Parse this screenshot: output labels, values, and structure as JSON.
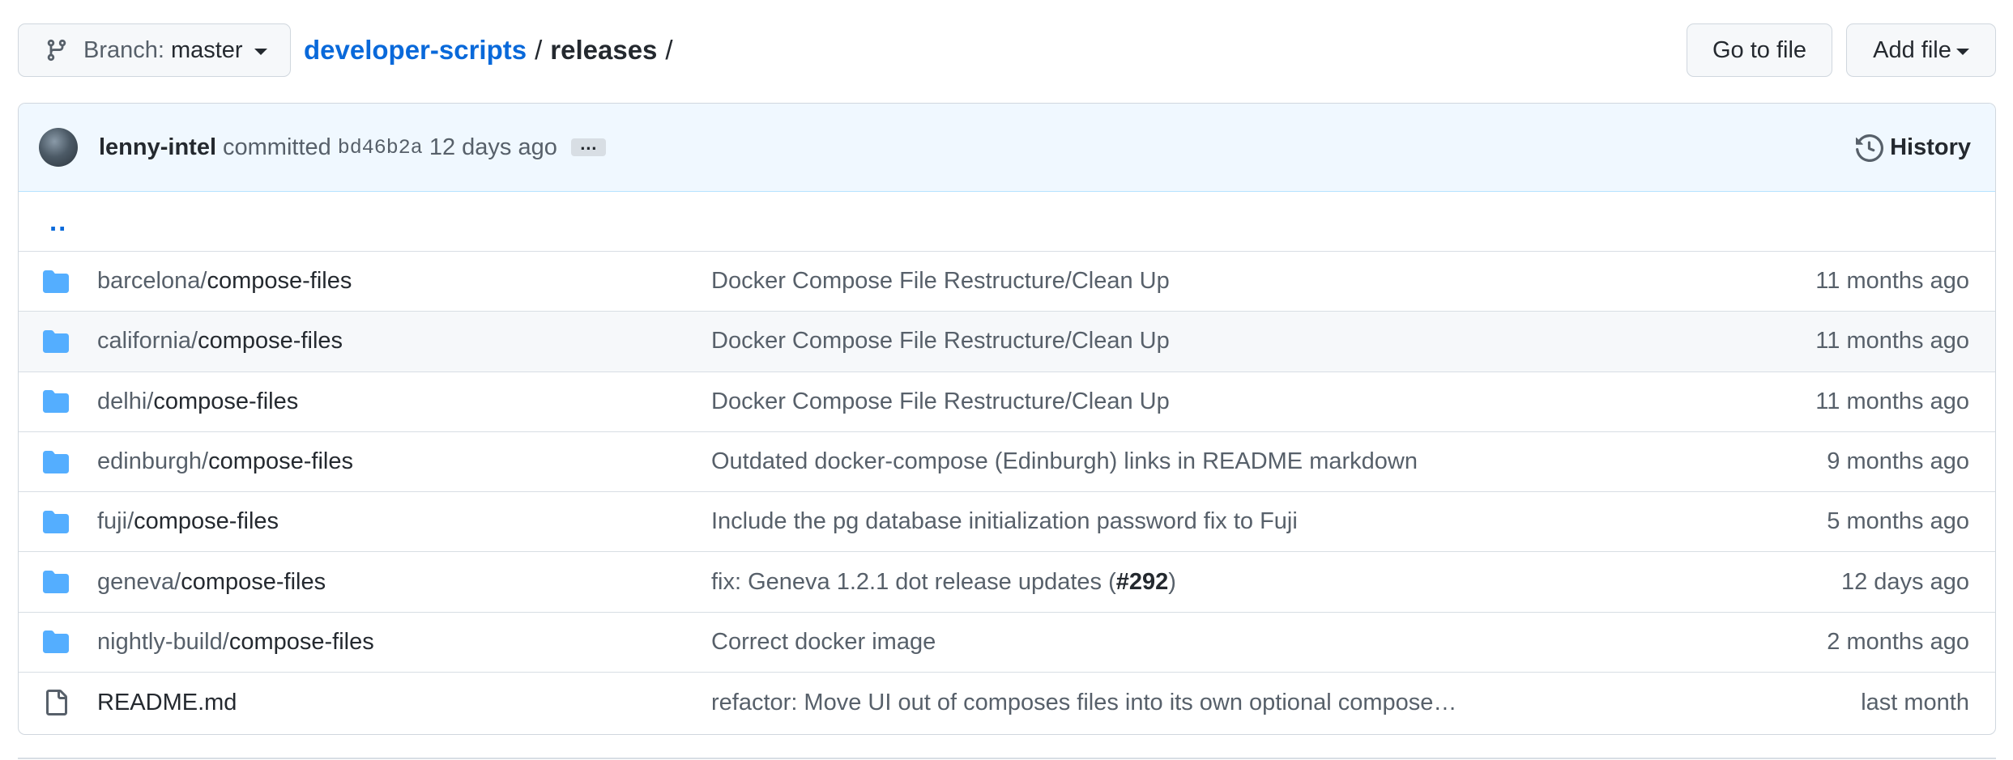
{
  "branch": {
    "label": "Branch:",
    "name": "master"
  },
  "breadcrumb": {
    "repo": "developer-scripts",
    "sep1": "/",
    "dir": "releases",
    "sep2": "/"
  },
  "buttons": {
    "go_to_file": "Go to file",
    "add_file": "Add file"
  },
  "commit": {
    "author": "lenny-intel",
    "verb": "committed",
    "sha": "bd46b2a",
    "time": "12 days ago",
    "ellipsis": "…",
    "history_label": "History"
  },
  "parent_dir": "..",
  "files": [
    {
      "type": "folder",
      "prefix": "barcelona/",
      "name": "compose-files",
      "message": "Docker Compose File Restructure/Clean Up",
      "age": "11 months ago"
    },
    {
      "type": "folder",
      "prefix": "california/",
      "name": "compose-files",
      "message": "Docker Compose File Restructure/Clean Up",
      "age": "11 months ago"
    },
    {
      "type": "folder",
      "prefix": "delhi/",
      "name": "compose-files",
      "message": "Docker Compose File Restructure/Clean Up",
      "age": "11 months ago"
    },
    {
      "type": "folder",
      "prefix": "edinburgh/",
      "name": "compose-files",
      "message": "Outdated docker-compose (Edinburgh) links in README markdown",
      "age": "9 months ago"
    },
    {
      "type": "folder",
      "prefix": "fuji/",
      "name": "compose-files",
      "message": "Include the pg database initialization password fix to Fuji",
      "age": "5 months ago"
    },
    {
      "type": "folder",
      "prefix": "geneva/",
      "name": "compose-files",
      "message": "fix: Geneva 1.2.1 dot release updates (",
      "message_pr": "#292",
      "message_end": ")",
      "age": "12 days ago"
    },
    {
      "type": "folder",
      "prefix": "nightly-build/",
      "name": "compose-files",
      "message": "Correct docker image",
      "age": "2 months ago"
    },
    {
      "type": "file",
      "prefix": "",
      "name": "README.md",
      "message": "refactor: Move UI out of composes files into its own optional compose…",
      "age": "last month"
    }
  ],
  "colors": {
    "link": "#0969da",
    "folder": "#54aeff",
    "muted": "#57606a",
    "text": "#24292f"
  },
  "icons": {
    "branch": "git-branch-icon",
    "history": "history-clock-icon",
    "folder": "folder-icon",
    "file": "file-icon"
  }
}
